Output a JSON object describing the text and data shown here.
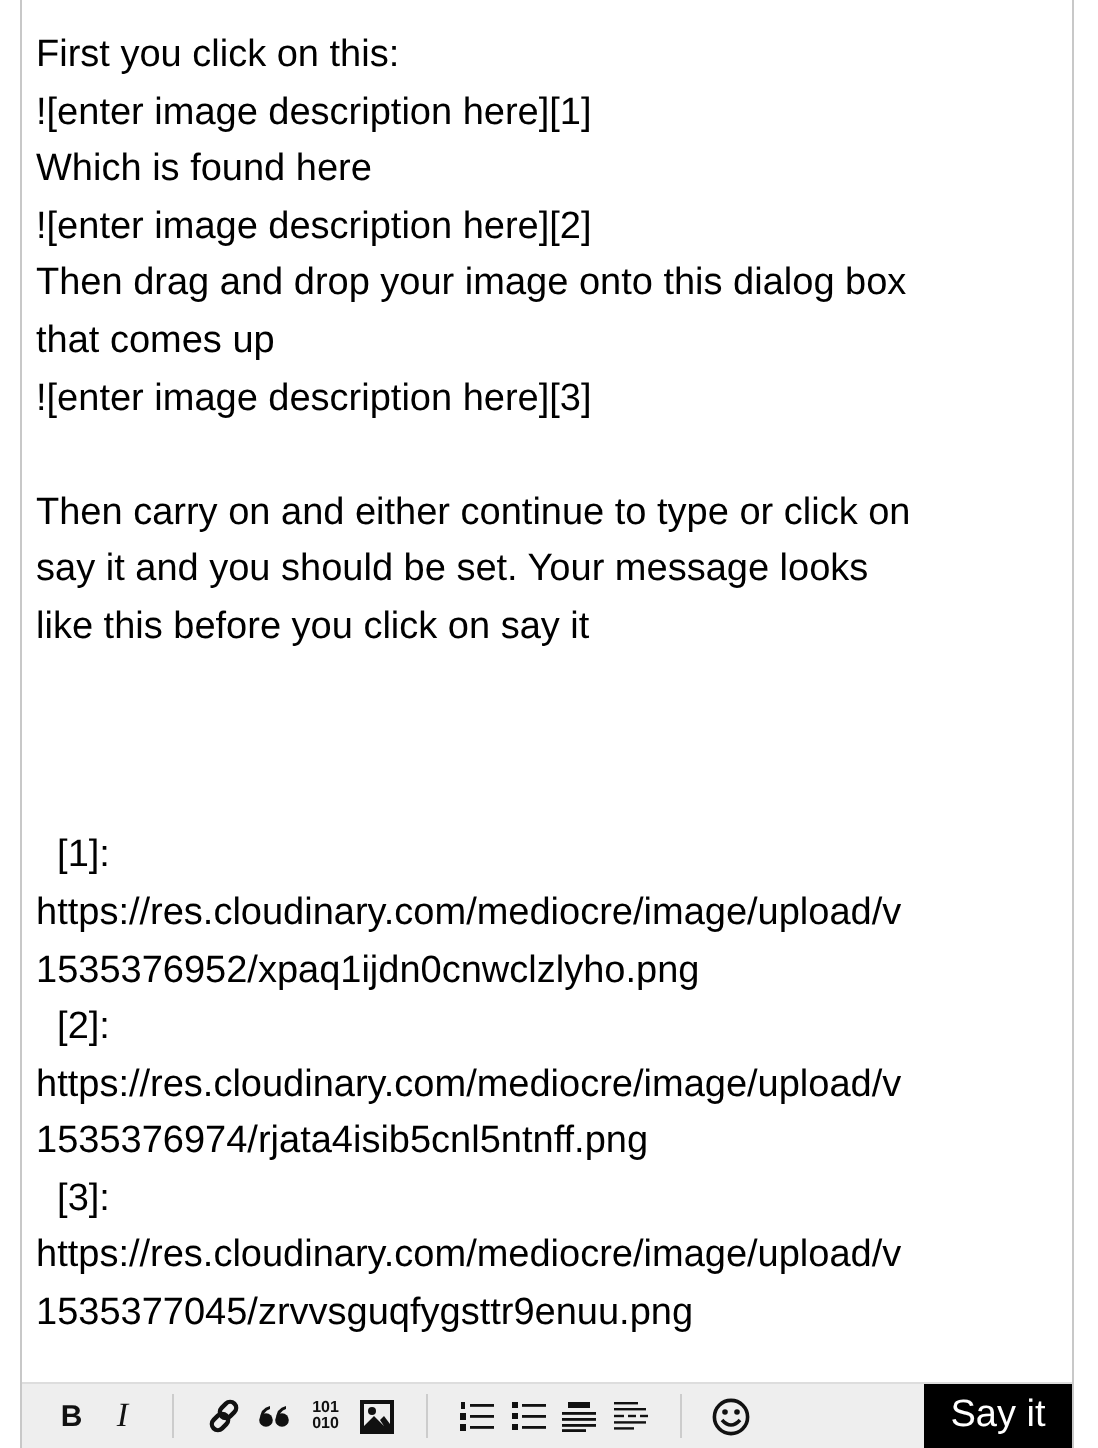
{
  "editor": {
    "lines": [
      {
        "kind": "text",
        "text": "First you click on this:"
      },
      {
        "kind": "text",
        "text": "![enter image description here][1]"
      },
      {
        "kind": "text",
        "text": "Which is found here"
      },
      {
        "kind": "text",
        "text": "![enter image description here][2]"
      },
      {
        "kind": "text",
        "text": "Then drag and drop your image onto this dialog box"
      },
      {
        "kind": "text",
        "text": "that comes up"
      },
      {
        "kind": "text",
        "text": "![enter image description here][3]"
      },
      {
        "kind": "blank"
      },
      {
        "kind": "text",
        "text": "Then carry on and either continue to type or click on"
      },
      {
        "kind": "text",
        "text": "say it and you should be set. Your message looks"
      },
      {
        "kind": "text",
        "text": "like this before you click on say it"
      },
      {
        "kind": "blank"
      },
      {
        "kind": "blank"
      },
      {
        "kind": "blank"
      },
      {
        "kind": "text",
        "text": "  [1]:"
      },
      {
        "kind": "text",
        "text": "https://res.cloudinary.com/mediocre/image/upload/v"
      },
      {
        "kind": "text",
        "text": "1535376952/xpaq1ijdn0cnwclzlyho.png"
      },
      {
        "kind": "text",
        "text": "  [2]:"
      },
      {
        "kind": "text",
        "text": "https://res.cloudinary.com/mediocre/image/upload/v"
      },
      {
        "kind": "text",
        "text": "1535376974/rjata4isib5cnl5ntnff.png"
      },
      {
        "kind": "text",
        "text": "  [3]:"
      },
      {
        "kind": "text",
        "text": "https://res.cloudinary.com/mediocre/image/upload/v"
      },
      {
        "kind": "text",
        "text": "1535377045/zrvvsguqfygsttr9enuu.png"
      }
    ]
  },
  "toolbar": {
    "tools": [
      {
        "kind": "bold",
        "label": "B"
      },
      {
        "kind": "italic",
        "label": "I"
      },
      {
        "kind": "separator"
      },
      {
        "kind": "link"
      },
      {
        "kind": "quote"
      },
      {
        "kind": "code",
        "label": "101\n010"
      },
      {
        "kind": "image"
      },
      {
        "kind": "separator"
      },
      {
        "kind": "ordered-list"
      },
      {
        "kind": "bullet-list"
      },
      {
        "kind": "heading"
      },
      {
        "kind": "rule"
      },
      {
        "kind": "separator"
      },
      {
        "kind": "emoji"
      }
    ],
    "submit": "Say it"
  }
}
